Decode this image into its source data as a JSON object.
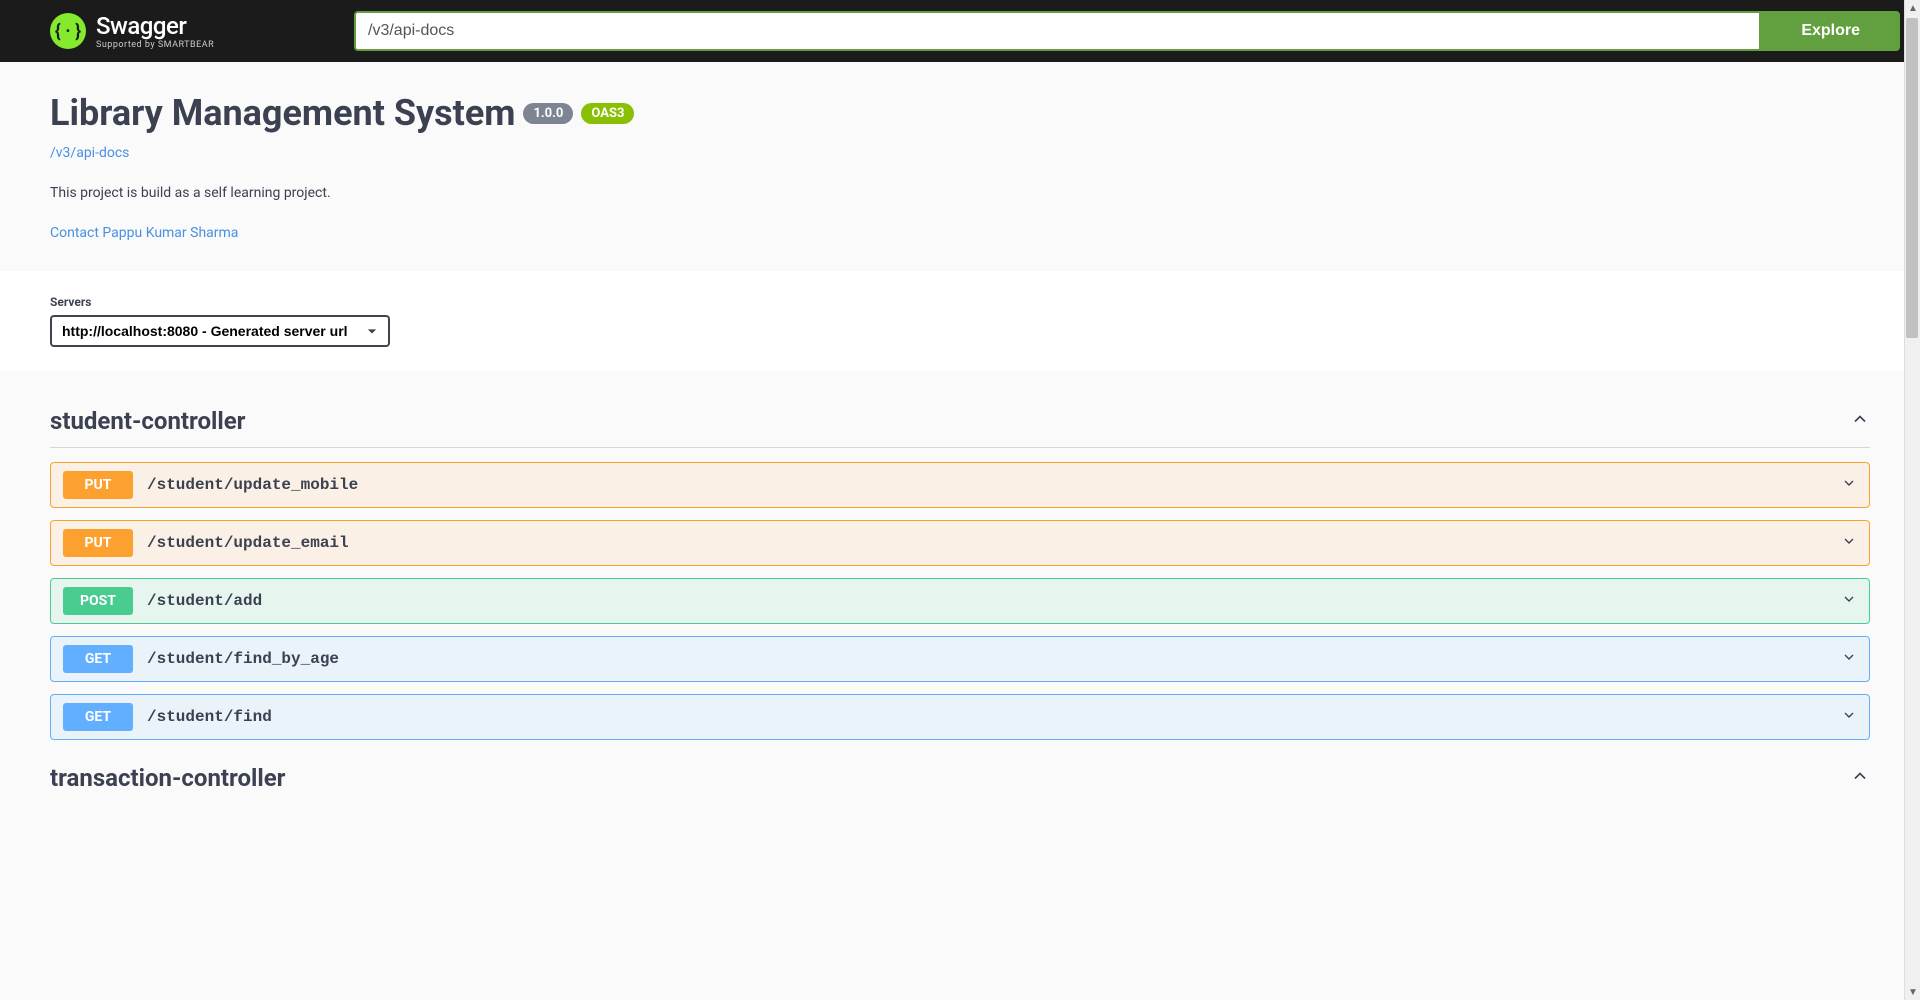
{
  "topbar": {
    "logo_text": "Swagger",
    "logo_subtitle": "Supported by SMARTBEAR",
    "url_value": "/v3/api-docs",
    "explore_label": "Explore"
  },
  "info": {
    "title": "Library Management System",
    "version": "1.0.0",
    "oas_version": "OAS3",
    "docs_link": "/v3/api-docs",
    "description": "This project is build as a self learning project.",
    "contact_text": "Contact Pappu Kumar Sharma"
  },
  "servers": {
    "label": "Servers",
    "selected": "http://localhost:8080 - Generated server url"
  },
  "controllers": [
    {
      "name": "student-controller",
      "endpoints": [
        {
          "method": "PUT",
          "path": "/student/update_mobile"
        },
        {
          "method": "PUT",
          "path": "/student/update_email"
        },
        {
          "method": "POST",
          "path": "/student/add"
        },
        {
          "method": "GET",
          "path": "/student/find_by_age"
        },
        {
          "method": "GET",
          "path": "/student/find"
        }
      ]
    },
    {
      "name": "transaction-controller",
      "endpoints": []
    }
  ]
}
